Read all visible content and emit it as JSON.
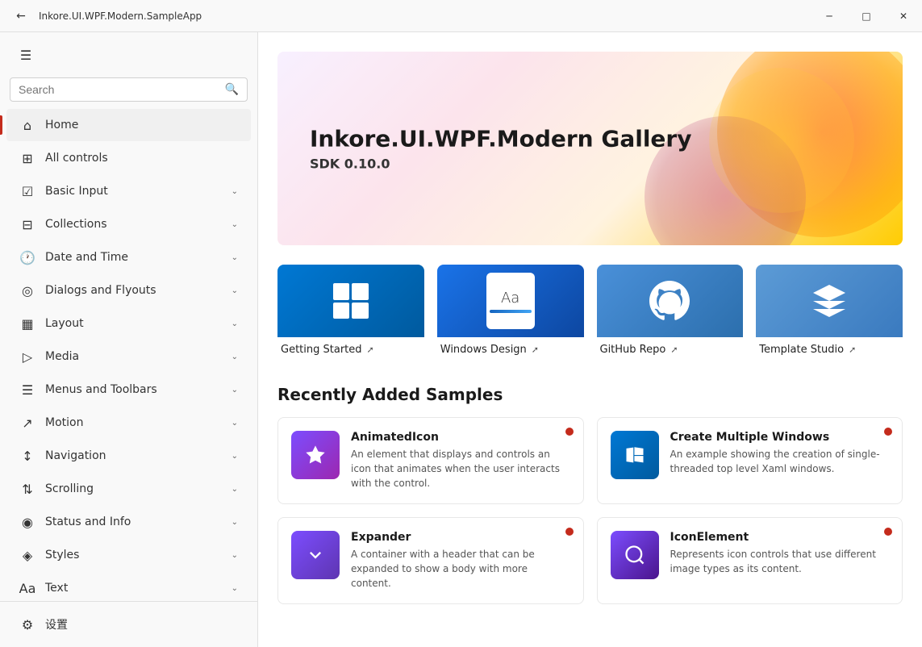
{
  "titlebar": {
    "title": "Inkore.UI.WPF.Modern.SampleApp",
    "back_label": "←",
    "minimize_label": "─",
    "maximize_label": "□",
    "close_label": "✕"
  },
  "sidebar": {
    "hamburger_label": "☰",
    "search_placeholder": "Search",
    "search_icon": "🔍",
    "nav_items": [
      {
        "id": "home",
        "label": "Home",
        "icon": "⌂",
        "active": true,
        "chevron": false
      },
      {
        "id": "all-controls",
        "label": "All controls",
        "icon": "⊞",
        "active": false,
        "chevron": false
      },
      {
        "id": "basic-input",
        "label": "Basic Input",
        "icon": "☑",
        "active": false,
        "chevron": true
      },
      {
        "id": "collections",
        "label": "Collections",
        "icon": "⊟",
        "active": false,
        "chevron": true
      },
      {
        "id": "date-and-time",
        "label": "Date and Time",
        "icon": "🕐",
        "active": false,
        "chevron": true
      },
      {
        "id": "dialogs-and-flyouts",
        "label": "Dialogs and Flyouts",
        "icon": "◎",
        "active": false,
        "chevron": true
      },
      {
        "id": "layout",
        "label": "Layout",
        "icon": "▦",
        "active": false,
        "chevron": true
      },
      {
        "id": "media",
        "label": "Media",
        "icon": "▷",
        "active": false,
        "chevron": true
      },
      {
        "id": "menus-and-toolbars",
        "label": "Menus and Toolbars",
        "icon": "⊟",
        "active": false,
        "chevron": true
      },
      {
        "id": "motion",
        "label": "Motion",
        "icon": "↗",
        "active": false,
        "chevron": true
      },
      {
        "id": "navigation",
        "label": "Navigation",
        "icon": "↕",
        "active": false,
        "chevron": true
      },
      {
        "id": "scrolling",
        "label": "Scrolling",
        "icon": "⇅",
        "active": false,
        "chevron": true
      },
      {
        "id": "status-and-info",
        "label": "Status and Info",
        "icon": "◉",
        "active": false,
        "chevron": true
      },
      {
        "id": "styles",
        "label": "Styles",
        "icon": "◈",
        "active": false,
        "chevron": true
      },
      {
        "id": "text",
        "label": "Text",
        "icon": "Aa",
        "active": false,
        "chevron": true
      }
    ],
    "settings_label": "设置",
    "settings_icon": "⚙"
  },
  "hero": {
    "title": "Inkore.UI.WPF.Modern Gallery",
    "subtitle": "SDK 0.10.0"
  },
  "quick_links": [
    {
      "id": "getting-started",
      "label": "Getting Started",
      "theme": "windows"
    },
    {
      "id": "windows-design",
      "label": "Windows Design",
      "theme": "design"
    },
    {
      "id": "github-repo",
      "label": "GitHub Repo",
      "theme": "github"
    },
    {
      "id": "template-studio",
      "label": "Template Studio",
      "theme": "template"
    }
  ],
  "recently_added": {
    "title": "Recently Added Samples",
    "items": [
      {
        "id": "animated-icon",
        "title": "AnimatedIcon",
        "desc": "An element that displays and controls an icon that animates when the user interacts with the control.",
        "thumb": "animated",
        "dot": true
      },
      {
        "id": "create-multiple-windows",
        "title": "Create Multiple Windows",
        "desc": "An example showing the creation of single-threaded top level Xaml windows.",
        "thumb": "windows",
        "dot": true
      },
      {
        "id": "expander",
        "title": "Expander",
        "desc": "A container with a header that can be expanded to show a body with more content.",
        "thumb": "expander",
        "dot": true
      },
      {
        "id": "icon-element",
        "title": "IconElement",
        "desc": "Represents icon controls that use different image types as its content.",
        "thumb": "icon",
        "dot": true
      }
    ]
  }
}
